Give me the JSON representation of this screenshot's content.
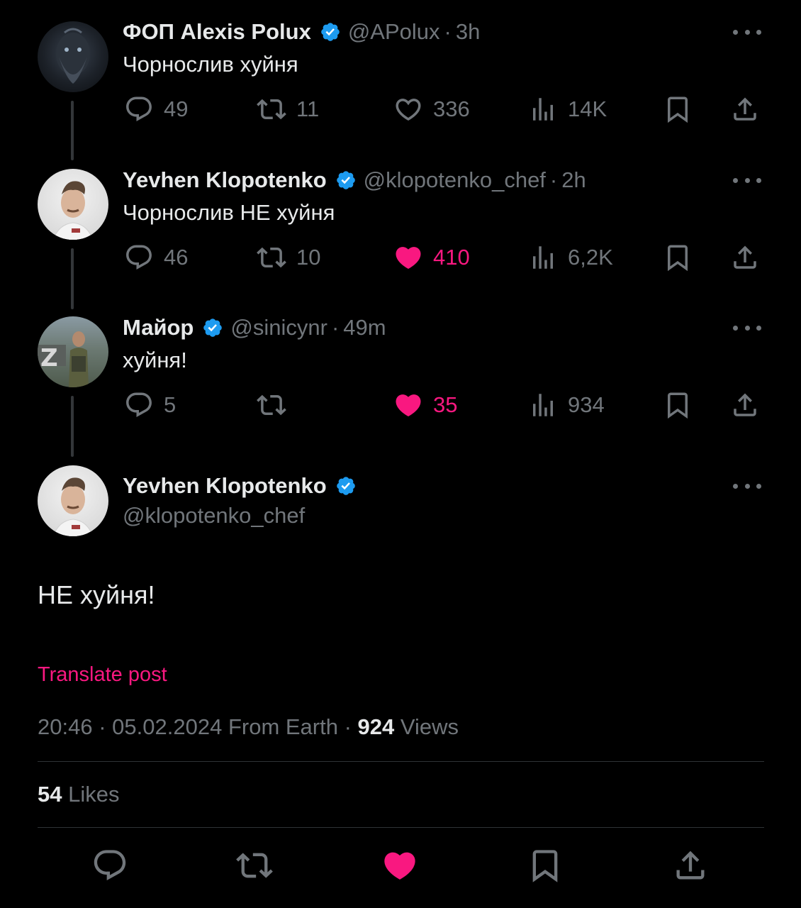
{
  "colors": {
    "background": "#000000",
    "text": "#e7e9ea",
    "muted": "#71767b",
    "verified": "#1d9bf0",
    "like": "#f91880"
  },
  "tweets": [
    {
      "name": "ФОП Alexis Polux",
      "handle": "@APolux",
      "time": "3h",
      "text": "Чорнослив хуйня",
      "replies": "49",
      "reposts": "11",
      "likes": "336",
      "views": "14K",
      "liked": false
    },
    {
      "name": "Yevhen Klopotenko",
      "handle": "@klopotenko_chef",
      "time": "2h",
      "text": "Чорнослив НЕ хуйня",
      "replies": "46",
      "reposts": "10",
      "likes": "410",
      "views": "6,2K",
      "liked": true
    },
    {
      "name": "Майор",
      "handle": "@sinicynr",
      "time": "49m",
      "text": "хуйня!",
      "replies": "5",
      "reposts": "",
      "likes": "35",
      "views": "934",
      "liked": true
    }
  ],
  "main_tweet": {
    "name": "Yevhen Klopotenko",
    "handle": "@klopotenko_chef",
    "text": "НЕ хуйня!",
    "translate": "Translate post",
    "time": "20:46",
    "date": "05.02.2024",
    "source": "From Earth",
    "views_count": "924",
    "views_label": "Views",
    "likes_count": "54",
    "likes_label": "Likes",
    "liked": true
  },
  "separator": "·"
}
